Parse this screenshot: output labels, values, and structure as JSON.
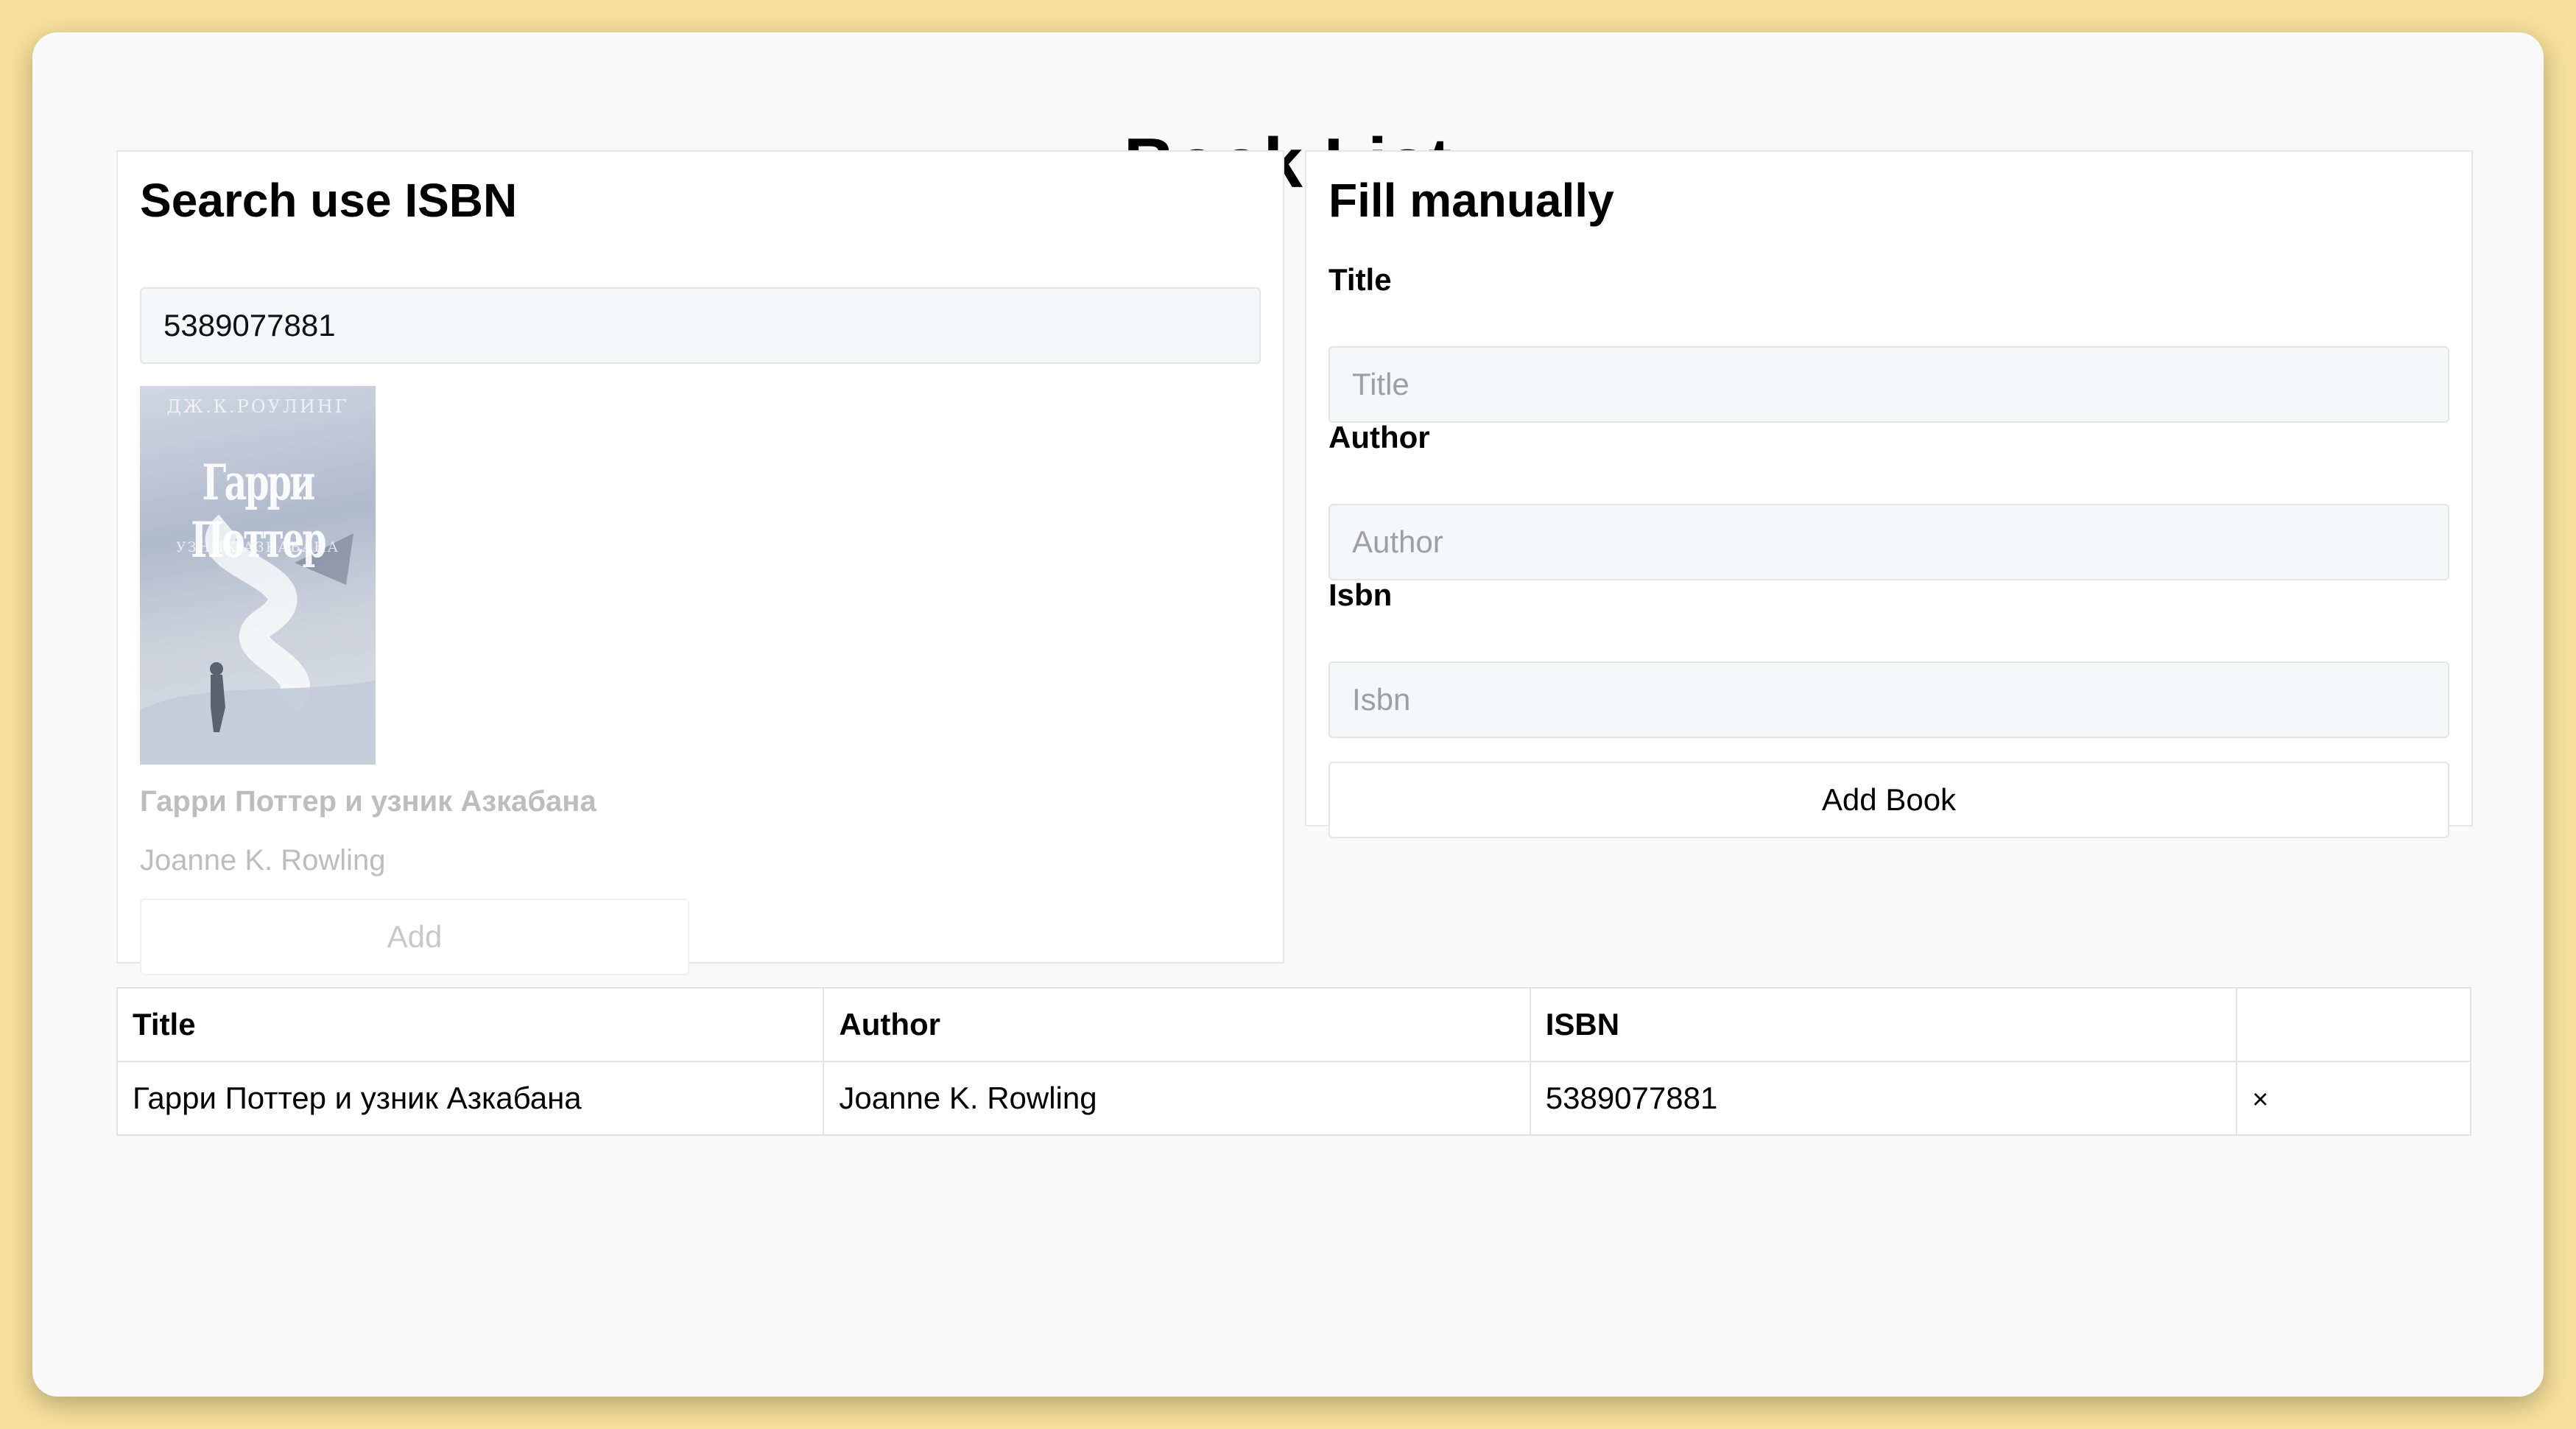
{
  "page": {
    "title": "Book List"
  },
  "search": {
    "heading": "Search use ISBN",
    "input_value": "5389077881",
    "result": {
      "cover": {
        "author_text": "ДЖ.К.РОУЛИНГ",
        "title_text": "Гарри Поттер",
        "subtitle_text": "УЗНИК АЗКАБАНА"
      },
      "title": "Гарри Поттер и узник Азкабана",
      "author": "Joanne K. Rowling",
      "add_label": "Add"
    }
  },
  "manual": {
    "heading": "Fill manually",
    "title_label": "Title",
    "title_placeholder": "Title",
    "author_label": "Author",
    "author_placeholder": "Author",
    "isbn_label": "Isbn",
    "isbn_placeholder": "Isbn",
    "submit_label": "Add Book"
  },
  "table": {
    "headers": [
      "Title",
      "Author",
      "ISBN",
      ""
    ],
    "rows": [
      {
        "title": "Гарри Поттер и узник Азкабана",
        "author": "Joanne K. Rowling",
        "isbn": "5389077881",
        "remove": "×"
      }
    ]
  },
  "colors": {
    "background": "#f6e09c",
    "card": "#f9f9f9",
    "field": "#f6f7f8"
  }
}
